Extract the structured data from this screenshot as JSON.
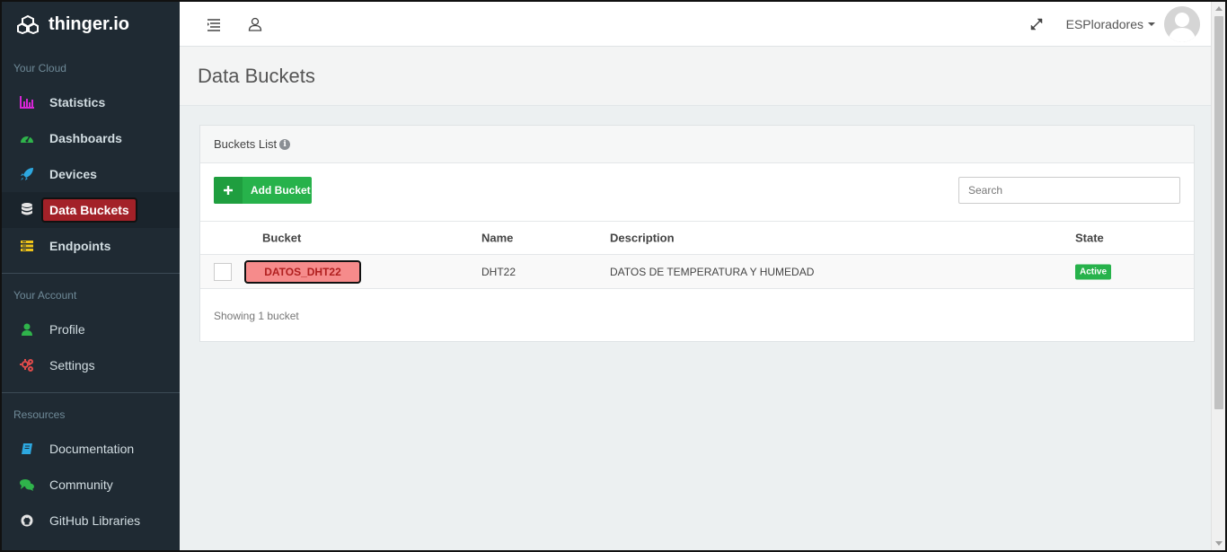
{
  "brand": {
    "name": "thinger.io"
  },
  "sidebar": {
    "sections": [
      {
        "label": "Your Cloud",
        "items": [
          {
            "label": "Statistics",
            "icon": "bar-chart-icon",
            "color": "#d626d6"
          },
          {
            "label": "Dashboards",
            "icon": "dashboard-icon",
            "color": "#2fb34b"
          },
          {
            "label": "Devices",
            "icon": "rocket-icon",
            "color": "#2da8e0"
          },
          {
            "label": "Data Buckets",
            "icon": "database-icon",
            "color": "#e5e5e5",
            "active": true
          },
          {
            "label": "Endpoints",
            "icon": "endpoint-icon",
            "color": "#f0c419"
          }
        ]
      },
      {
        "label": "Your Account",
        "items": [
          {
            "label": "Profile",
            "icon": "user-icon",
            "color": "#2fb34b"
          },
          {
            "label": "Settings",
            "icon": "cogs-icon",
            "color": "#e04b4b"
          }
        ]
      },
      {
        "label": "Resources",
        "items": [
          {
            "label": "Documentation",
            "icon": "book-icon",
            "color": "#2da8e0"
          },
          {
            "label": "Community",
            "icon": "comments-icon",
            "color": "#2fb34b"
          },
          {
            "label": "GitHub Libraries",
            "icon": "github-icon",
            "color": "#e5e5e5"
          }
        ]
      }
    ]
  },
  "topbar": {
    "user": "ESPloradores"
  },
  "page": {
    "title": "Data Buckets"
  },
  "panel": {
    "heading": "Buckets List",
    "add_button": "Add Bucket",
    "search_placeholder": "Search",
    "columns": {
      "bucket": "Bucket",
      "name": "Name",
      "description": "Description",
      "state": "State"
    },
    "rows": [
      {
        "bucket": "DATOS_DHT22",
        "name": "DHT22",
        "description": "DATOS DE TEMPERATURA Y HUMEDAD",
        "state": "Active"
      }
    ],
    "footer": "Showing 1 bucket"
  },
  "colors": {
    "sidebar_bg": "#1f2a33",
    "accent_green": "#27b24b",
    "highlight_red": "#a32128"
  }
}
